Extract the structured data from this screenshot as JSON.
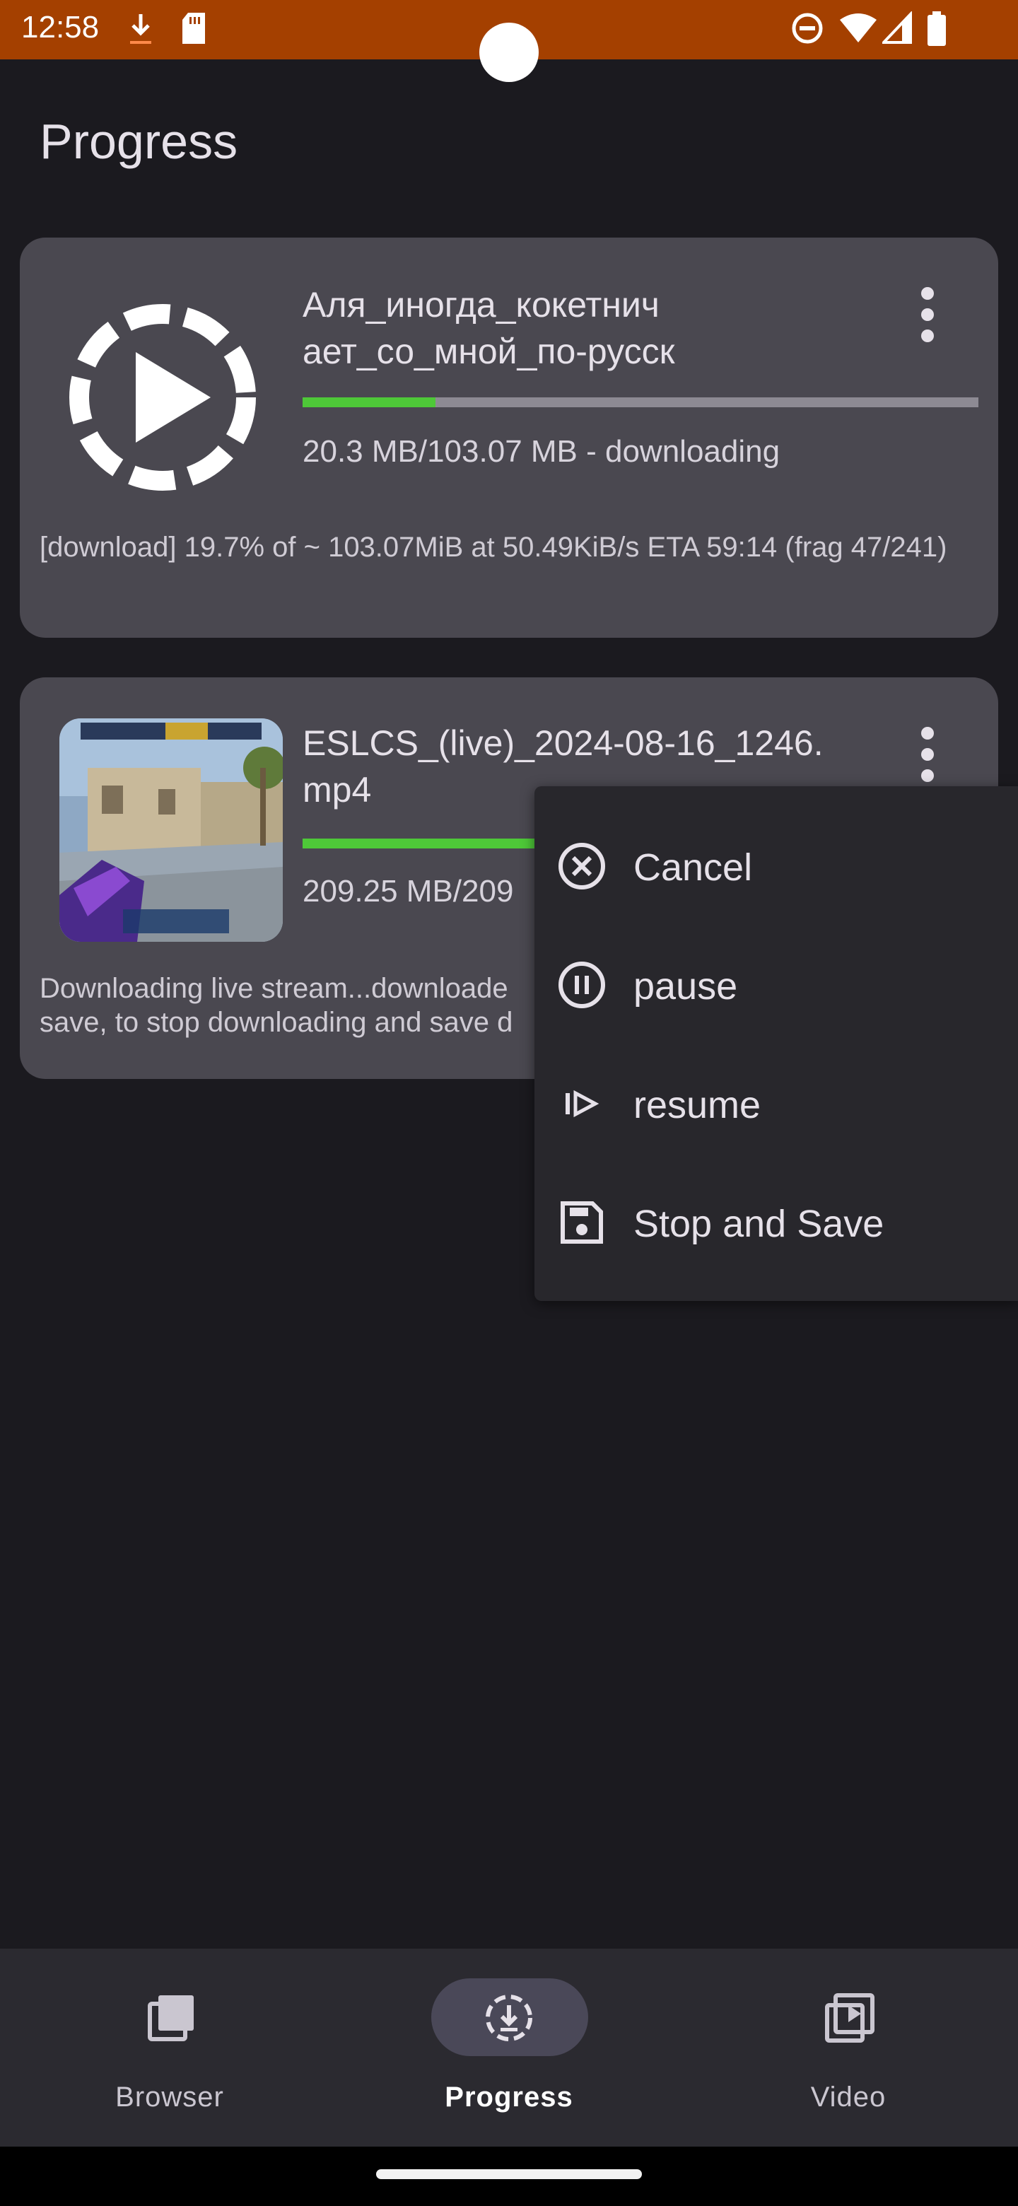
{
  "status_bar": {
    "time": "12:58",
    "left_icons": [
      "download-icon",
      "sdcard-icon"
    ],
    "right_icons": [
      "dnd-icon",
      "wifi-icon",
      "signal-icon",
      "battery-icon"
    ]
  },
  "page": {
    "title": "Progress"
  },
  "downloads": [
    {
      "title": "Аля_иногда_кокетнич\nает_со_мной_по-русск",
      "thumbnail": "play-loading-icon",
      "progress": 0.197,
      "size_text": "20.3 MB/103.07 MB - downloading",
      "log_text": "[download]  19.7% of ~ 103.07MiB at   50.49KiB/s ETA 59:14 (frag 47/241)"
    },
    {
      "title": "ESLCS_(live)_2024-08-16_1246.\nmp4",
      "thumbnail": "video-thumbnail",
      "progress": 0.55,
      "size_text": "209.25 MB/209",
      "log_text": "Downloading live stream...downloade\nsave, to stop downloading and save d"
    }
  ],
  "menu": {
    "items": [
      {
        "label": "Cancel",
        "icon": "cancel-icon"
      },
      {
        "label": "pause",
        "icon": "pause-icon"
      },
      {
        "label": "resume",
        "icon": "resume-icon"
      },
      {
        "label": "Stop and Save",
        "icon": "save-icon"
      }
    ]
  },
  "bottom_nav": {
    "items": [
      {
        "label": "Browser",
        "icon": "browser-icon",
        "active": false
      },
      {
        "label": "Progress",
        "icon": "progress-icon",
        "active": true
      },
      {
        "label": "Video",
        "icon": "video-icon",
        "active": false
      }
    ]
  },
  "colors": {
    "status_bar": "#a44000",
    "background": "#1b1a1f",
    "card": "#4a4850",
    "progress_fill": "#4ec838",
    "menu": "#28272c"
  }
}
